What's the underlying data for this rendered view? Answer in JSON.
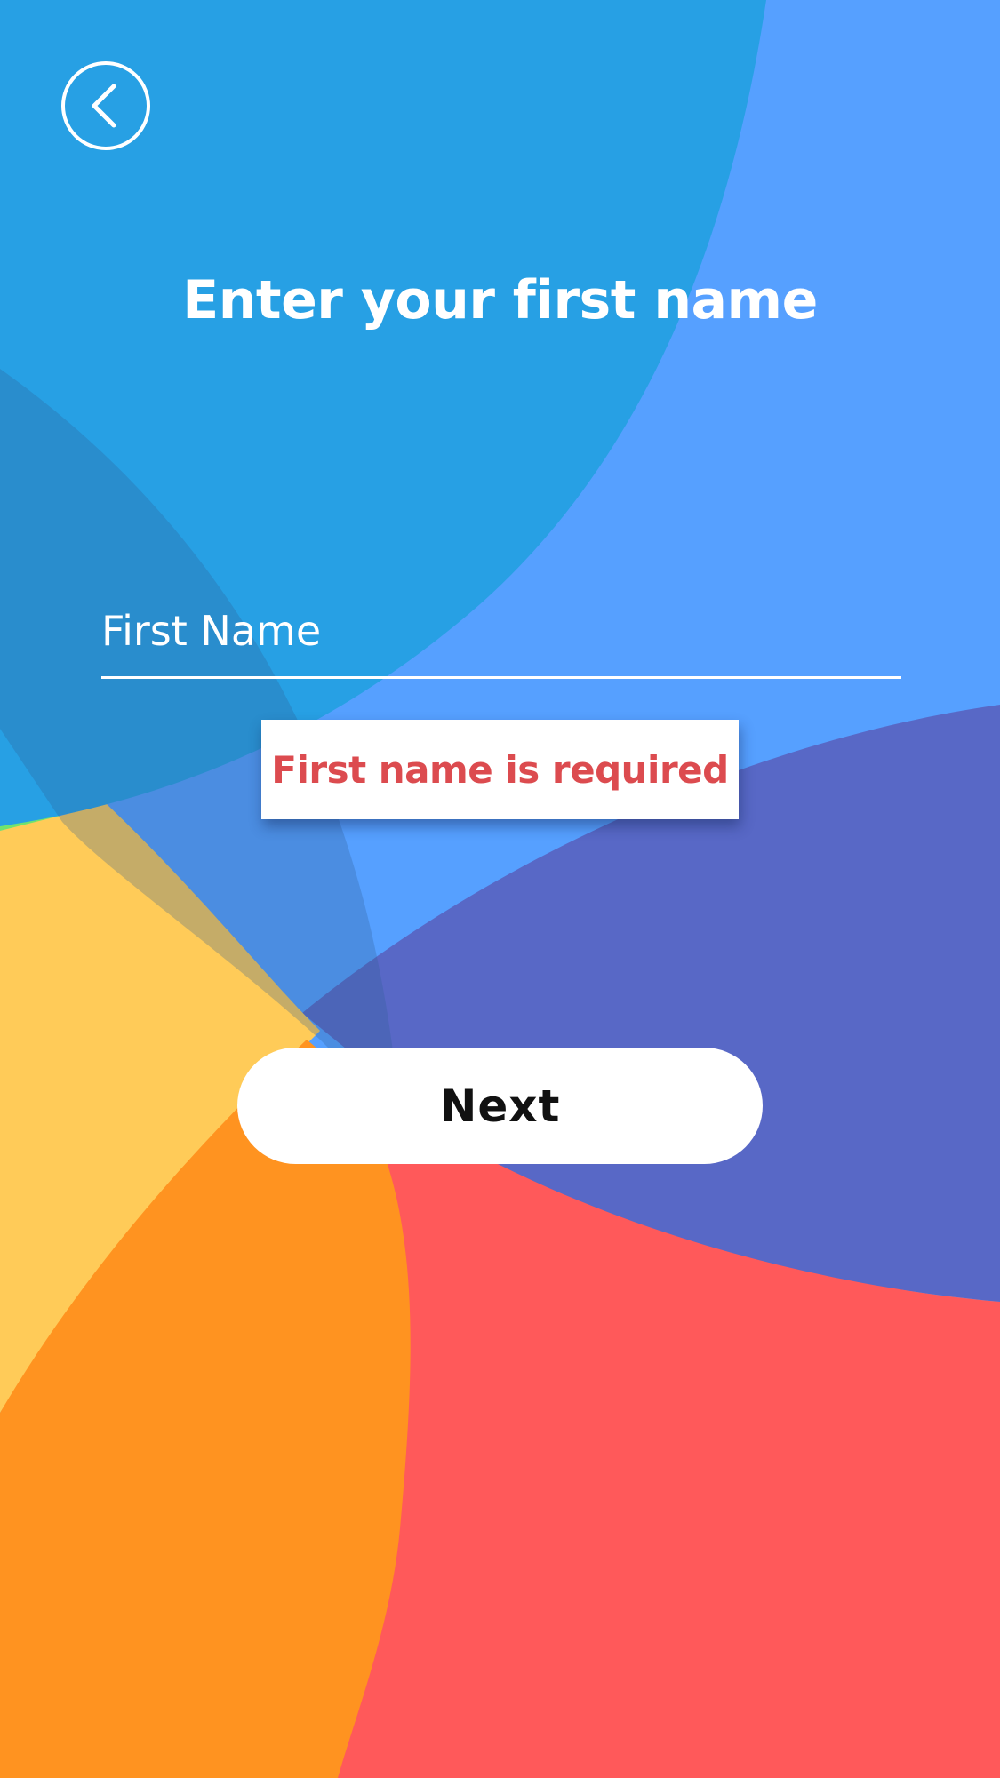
{
  "colors": {
    "sky_blue": "#27a0e4",
    "light_blue": "#56a0ff",
    "indigo": "#5868c6",
    "coral": "#ff595a",
    "orange": "#ff9320",
    "yellow": "#ffcb58",
    "green": "#6fe36f",
    "error_red": "#dc4b4f"
  },
  "header": {
    "back_icon": "chevron-left-icon"
  },
  "main": {
    "title": "Enter your first name",
    "first_name_input": {
      "placeholder": "First Name",
      "value": ""
    },
    "error_message": "First name is required",
    "next_label": "Next"
  }
}
